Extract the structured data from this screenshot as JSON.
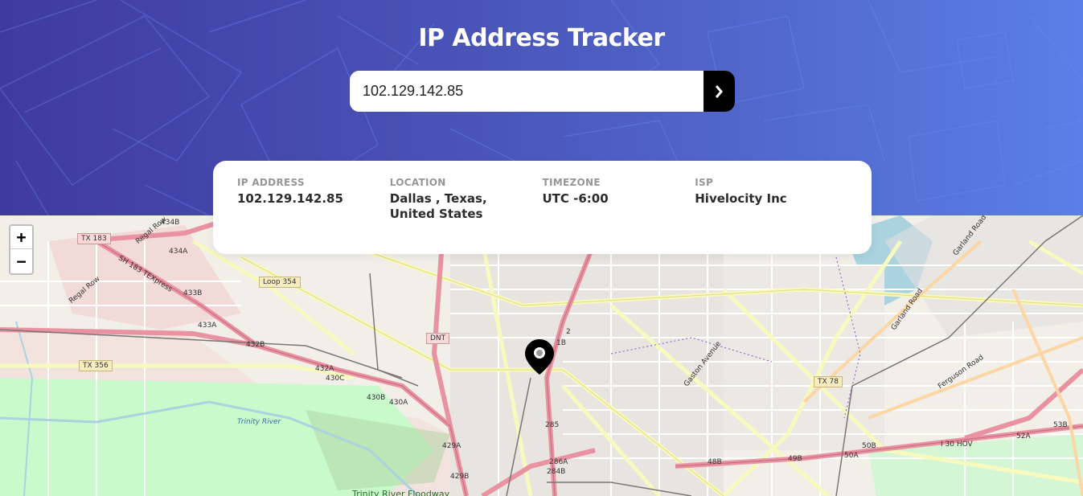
{
  "header": {
    "title": "IP Address Tracker"
  },
  "search": {
    "value": "102.129.142.85",
    "submit_icon": "chevron-right-icon"
  },
  "info": {
    "ip_label": "IP ADDRESS",
    "ip_value": "102.129.142.85",
    "location_label": "LOCATION",
    "location_line1": "Dallas , Texas,",
    "location_line2": "United States",
    "timezone_label": "TIMEZONE",
    "timezone_value": "UTC -6:00",
    "isp_label": "ISP",
    "isp_value": "Hivelocity Inc"
  },
  "map": {
    "zoom_in": "+",
    "zoom_out": "−",
    "marker_icon": "map-pin-icon",
    "labels": {
      "tx183": "TX 183",
      "regal_row_1": "Regal Row",
      "regal_row_2": "Regal Row",
      "sh183": "SH 183 TEXpress",
      "loop354": "Loop 354",
      "tx356": "TX 356",
      "dnt": "DNT",
      "tx78": "TX 78",
      "trinity_river": "Trinity River",
      "trinity_floodway": "Trinity River Floodway",
      "gaston_avenue": "Gaston Avenue",
      "garland_road_1": "Garland Road",
      "garland_road_2": "Garland Road",
      "ferguson_road": "Ferguson Road",
      "i30hov": "I 30 HOV",
      "x434b": "434B",
      "x434a": "434A",
      "x433b": "433B",
      "x433a": "433A",
      "x432b": "432B",
      "x432a": "432A",
      "x430c": "430C",
      "x430b": "430B",
      "x430a": "430A",
      "x429a": "429A",
      "x429b": "429B",
      "x285": "285",
      "x284b": "284B",
      "x286a": "286A",
      "x1b": "1B",
      "x2": "2",
      "x48b": "48B",
      "x49b": "49B",
      "x50a": "50A",
      "x50b": "50B",
      "x52a": "52A",
      "x53b": "53B"
    }
  },
  "colors": {
    "hero_start": "#3f3aa0",
    "hero_end": "#5a7fe6",
    "button_bg": "#000000",
    "card_bg": "#ffffff",
    "highway": "#e892a2",
    "primary_road": "#f7fabf",
    "park": "#c8facc",
    "water": "#aad3df"
  }
}
